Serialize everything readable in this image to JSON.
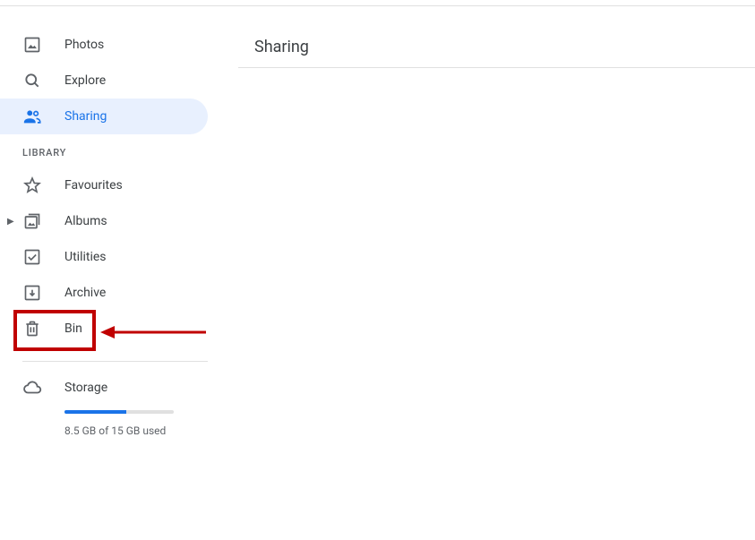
{
  "page": {
    "title": "Sharing"
  },
  "sidebar": {
    "main_items": [
      {
        "label": "Photos"
      },
      {
        "label": "Explore"
      },
      {
        "label": "Sharing"
      }
    ],
    "library_header": "LIBRARY",
    "library_items": [
      {
        "label": "Favourites"
      },
      {
        "label": "Albums"
      },
      {
        "label": "Utilities"
      },
      {
        "label": "Archive"
      },
      {
        "label": "Bin"
      }
    ]
  },
  "storage": {
    "label": "Storage",
    "text": "8.5 GB of 15 GB used"
  }
}
